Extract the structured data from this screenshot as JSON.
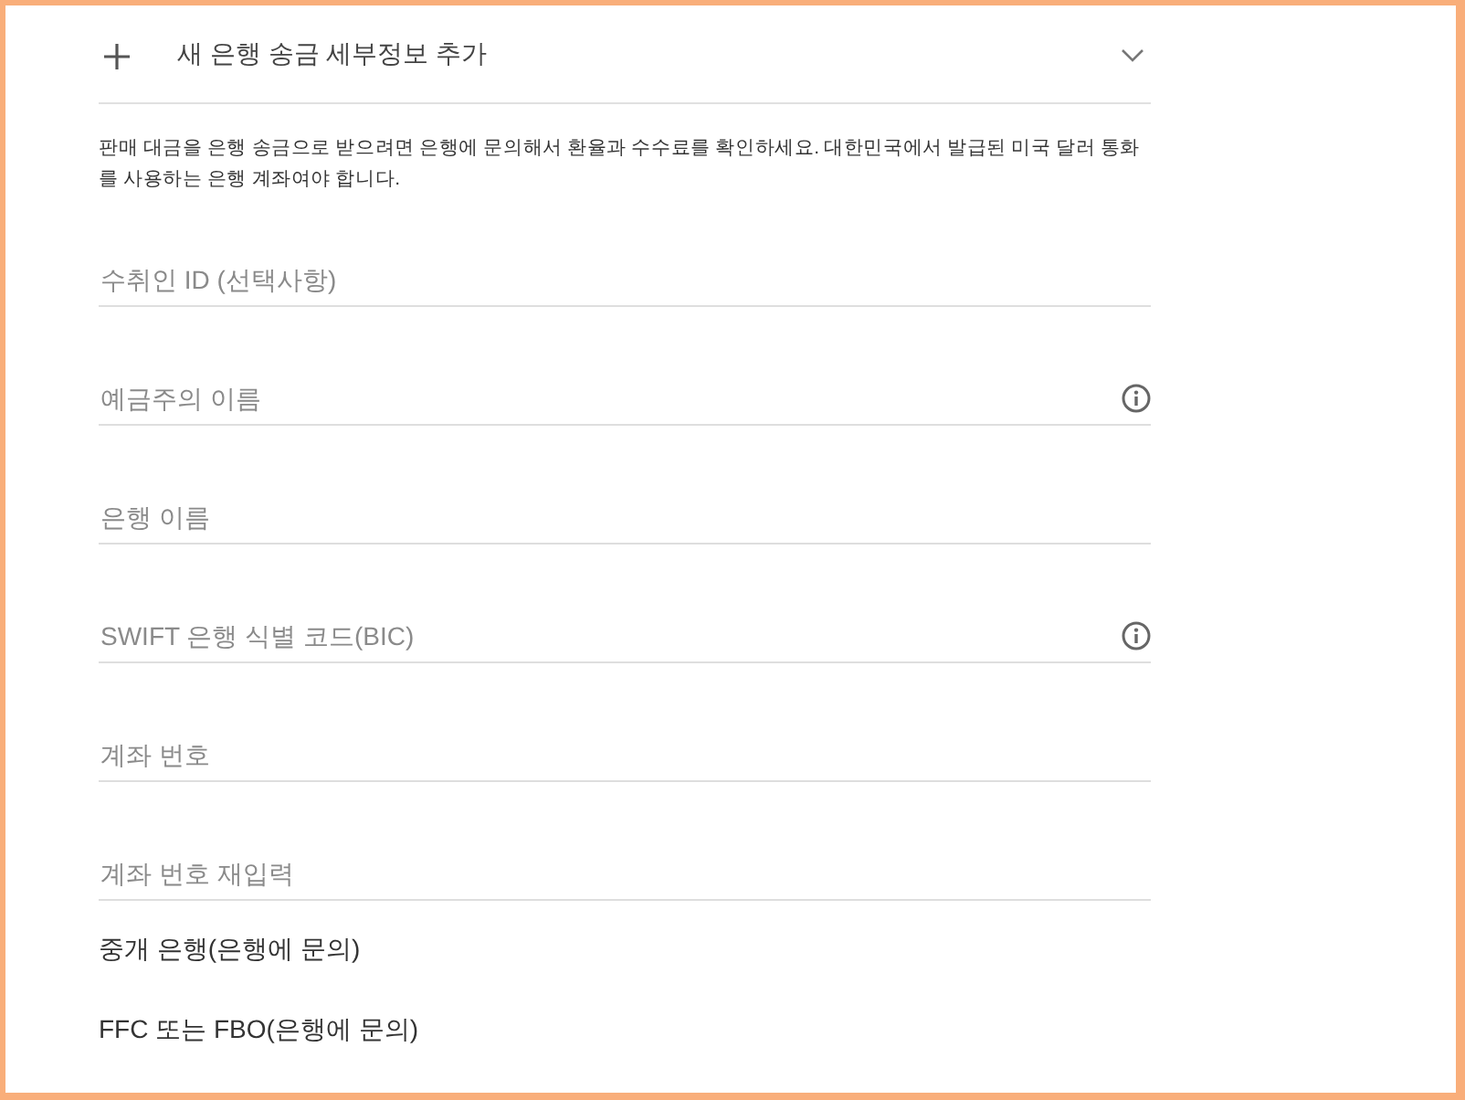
{
  "header": {
    "title": "새 은행 송금 세부정보 추가"
  },
  "description": "판매 대금을 은행 송금으로 받으려면 은행에 문의해서 환율과 수수료를 확인하세요. 대한민국에서 발급된 미국 달러 통화를 사용하는 은행 계좌여야 합니다.",
  "fields": [
    {
      "placeholder": "수취인 ID (선택사항)",
      "info": false
    },
    {
      "placeholder": "예금주의 이름",
      "info": true
    },
    {
      "placeholder": "은행 이름",
      "info": false
    },
    {
      "placeholder": "SWIFT 은행 식별 코드(BIC)",
      "info": true
    },
    {
      "placeholder": "계좌 번호",
      "info": false
    },
    {
      "placeholder": "계좌 번호 재입력",
      "info": false
    }
  ],
  "sections": [
    {
      "label": "중개 은행(은행에 문의)"
    },
    {
      "label": "FFC 또는 FBO(은행에 문의)"
    }
  ]
}
